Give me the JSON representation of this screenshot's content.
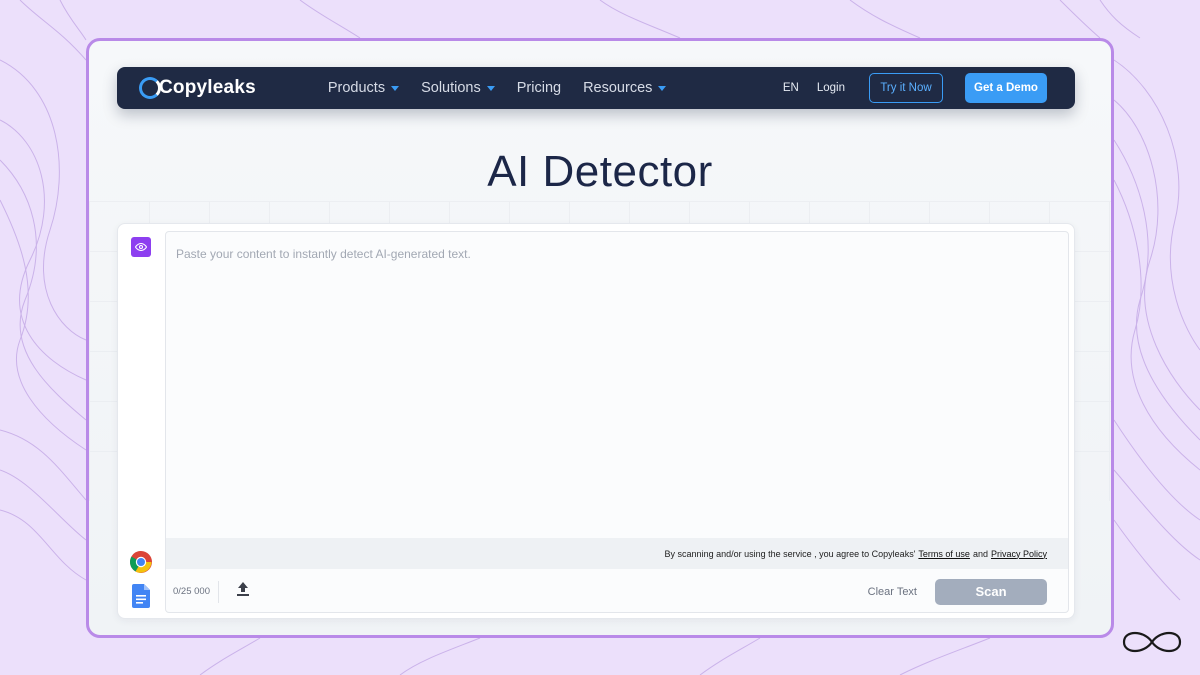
{
  "navbar": {
    "logo_text": "Copyleaks",
    "links": [
      "Products",
      "Solutions",
      "Pricing",
      "Resources"
    ],
    "language": "EN",
    "login": "Login",
    "try_button": "Try it Now",
    "demo_button": "Get a Demo"
  },
  "page": {
    "title": "AI Detector"
  },
  "editor": {
    "placeholder": "Paste your content to instantly detect AI-generated text.",
    "terms_prefix": "By scanning and/or using the service , you agree to Copyleaks'",
    "terms_link": "Terms of use",
    "terms_and": "and",
    "privacy_link": "Privacy Policy",
    "char_count": "0/25 000",
    "clear_text": "Clear Text",
    "scan_button": "Scan"
  },
  "colors": {
    "navbar": "#1f2a44",
    "accent": "#3a9cf5",
    "frame_border": "#b98ae8",
    "background": "#ece0fb",
    "scan_disabled": "#a3adbd",
    "eye_button": "#8d3ff0"
  },
  "icons": [
    "eye-icon",
    "chrome-icon",
    "google-docs-icon",
    "upload-icon",
    "infinity-icon"
  ]
}
